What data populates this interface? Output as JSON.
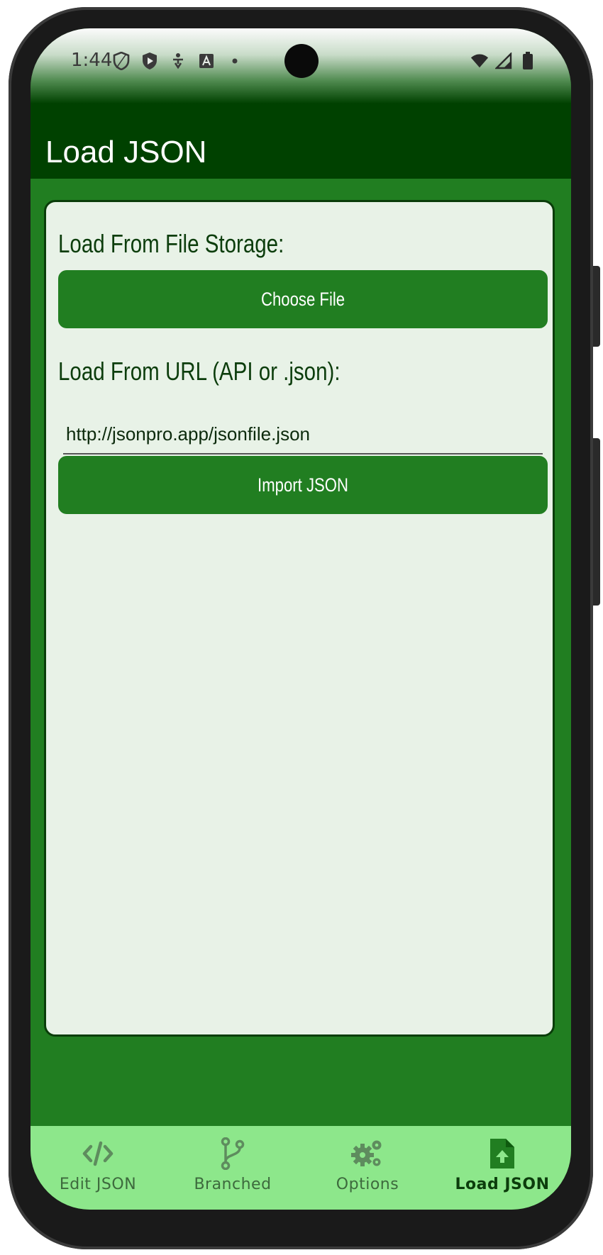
{
  "status_bar": {
    "time": "1:44",
    "left_icons": [
      "shield-outline-icon",
      "shield-play-icon",
      "accessibility-download-icon",
      "font-a-icon",
      "dot-icon"
    ],
    "right_icons": [
      "wifi-icon",
      "signal-icon",
      "battery-icon"
    ]
  },
  "app_bar": {
    "title": "Load JSON"
  },
  "card": {
    "file_section_label": "Load From File Storage:",
    "choose_file_button": "Choose File",
    "url_section_label": "Load From URL (API or .json):",
    "url_input_value": "http://jsonpro.app/jsonfile.json",
    "import_button": "Import JSON"
  },
  "bottom_nav": {
    "items": [
      {
        "label": "Edit JSON",
        "icon": "code-icon",
        "active": false
      },
      {
        "label": "Branched",
        "icon": "git-branch-icon",
        "active": false
      },
      {
        "label": "Options",
        "icon": "gears-icon",
        "active": false
      },
      {
        "label": "Load JSON",
        "icon": "file-upload-icon",
        "active": true
      }
    ]
  },
  "colors": {
    "app_bar": "#004100",
    "primary": "#217e21",
    "card_bg": "#e8f2e7",
    "nav_bg": "#8de78b",
    "nav_inactive": "#3d6a3d",
    "nav_active": "#0c3d0c"
  }
}
